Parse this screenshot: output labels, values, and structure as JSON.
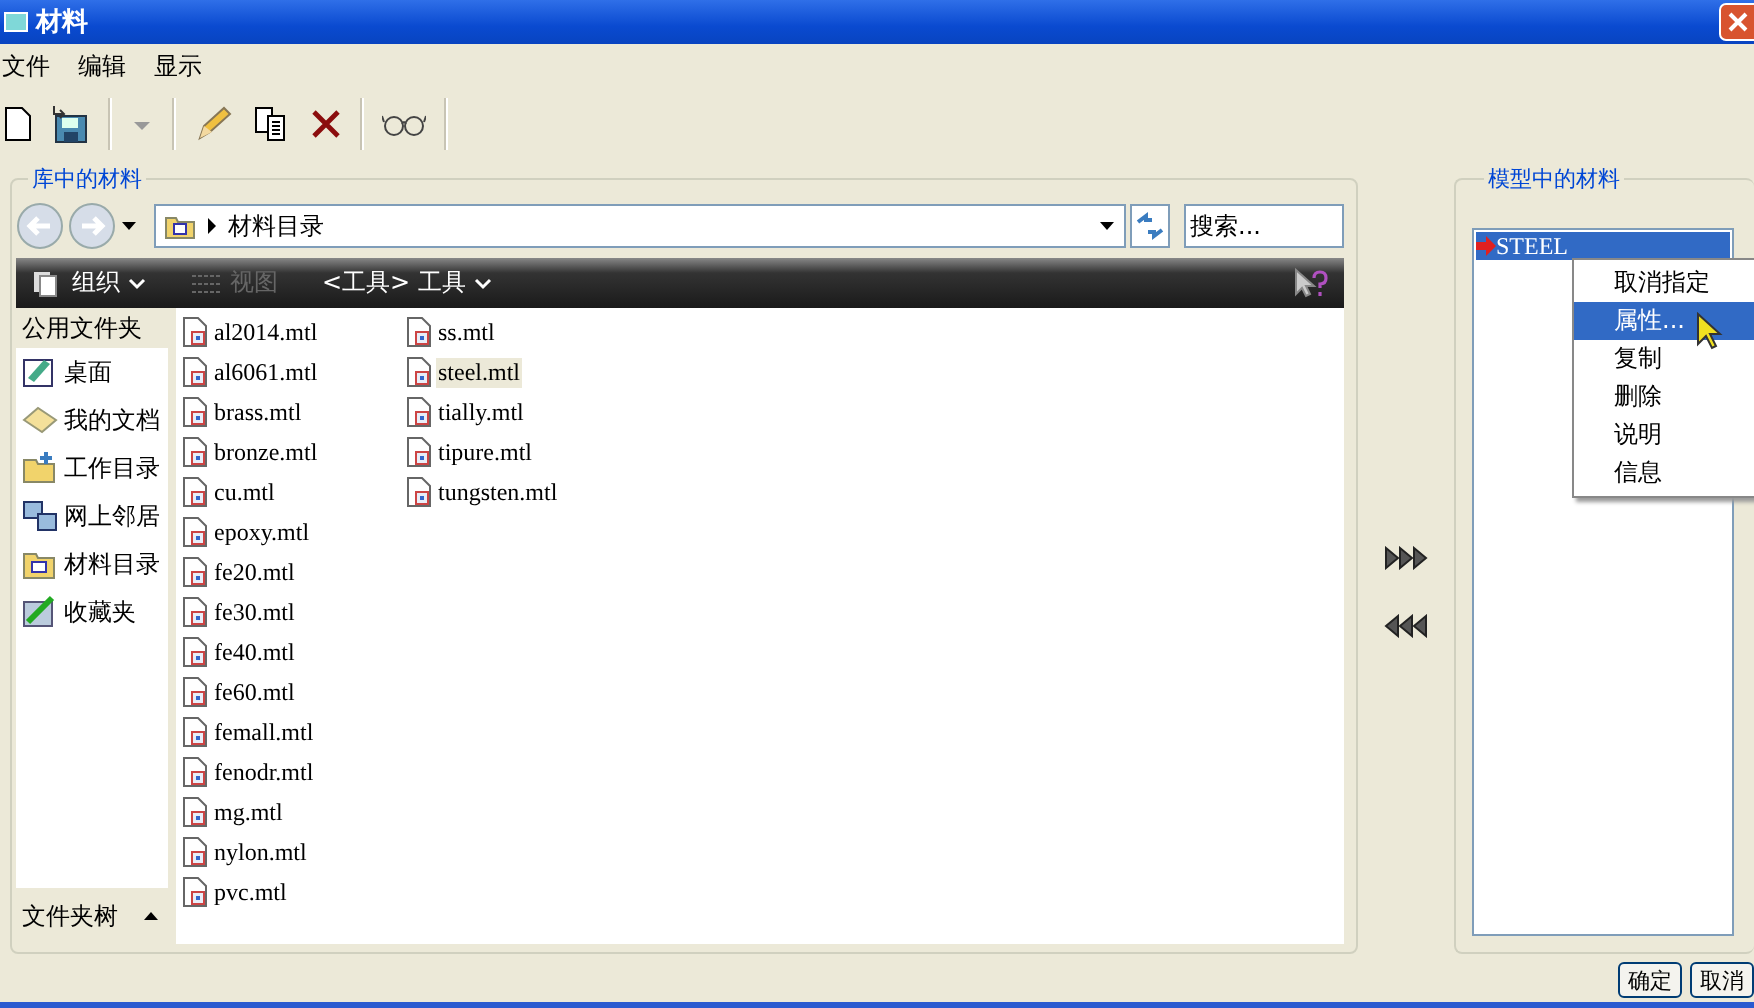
{
  "window": {
    "title": "材料"
  },
  "menu": [
    "文件",
    "编辑",
    "显示"
  ],
  "library": {
    "title": "库中的材料",
    "path": "材料目录",
    "search": {
      "placeholder": "搜索..."
    },
    "commands": [
      {
        "label": "组织",
        "disabled": false,
        "kind": "organize"
      },
      {
        "label": "视图",
        "disabled": true,
        "kind": "view"
      },
      {
        "label": "<工具> 工具",
        "disabled": false,
        "kind": "tools"
      }
    ],
    "sidebar": {
      "heading": "公用文件夹",
      "items": [
        {
          "label": "桌面",
          "kind": "desktop"
        },
        {
          "label": "我的文档",
          "kind": "documents"
        },
        {
          "label": "工作目录",
          "kind": "workdir"
        },
        {
          "label": "网上邻居",
          "kind": "network"
        },
        {
          "label": "材料目录",
          "kind": "folder"
        },
        {
          "label": "收藏夹",
          "kind": "favorites"
        }
      ],
      "footer": "文件夹树"
    },
    "files": [
      {
        "name": "al2014.mtl",
        "selected": false
      },
      {
        "name": "al6061.mtl",
        "selected": false
      },
      {
        "name": "brass.mtl",
        "selected": false
      },
      {
        "name": "bronze.mtl",
        "selected": false
      },
      {
        "name": "cu.mtl",
        "selected": false
      },
      {
        "name": "epoxy.mtl",
        "selected": false
      },
      {
        "name": "fe20.mtl",
        "selected": false
      },
      {
        "name": "fe30.mtl",
        "selected": false
      },
      {
        "name": "fe40.mtl",
        "selected": false
      },
      {
        "name": "fe60.mtl",
        "selected": false
      },
      {
        "name": "femall.mtl",
        "selected": false
      },
      {
        "name": "fenodr.mtl",
        "selected": false
      },
      {
        "name": "mg.mtl",
        "selected": false
      },
      {
        "name": "nylon.mtl",
        "selected": false
      },
      {
        "name": "pvc.mtl",
        "selected": false
      },
      {
        "name": "ss.mtl",
        "selected": false
      },
      {
        "name": "steel.mtl",
        "selected": true
      },
      {
        "name": "tially.mtl",
        "selected": false
      },
      {
        "name": "tipure.mtl",
        "selected": false
      },
      {
        "name": "tungsten.mtl",
        "selected": false
      }
    ]
  },
  "model": {
    "title": "模型中的材料",
    "items": [
      {
        "label": "STEEL",
        "selected": true
      }
    ]
  },
  "context_menu": [
    {
      "label": "取消指定",
      "selected": false
    },
    {
      "label": "属性...",
      "selected": true
    },
    {
      "label": "复制",
      "selected": false
    },
    {
      "label": "删除",
      "selected": false
    },
    {
      "label": "说明",
      "selected": false
    },
    {
      "label": "信息",
      "selected": false
    }
  ],
  "buttons": [
    "确定",
    "取消"
  ]
}
